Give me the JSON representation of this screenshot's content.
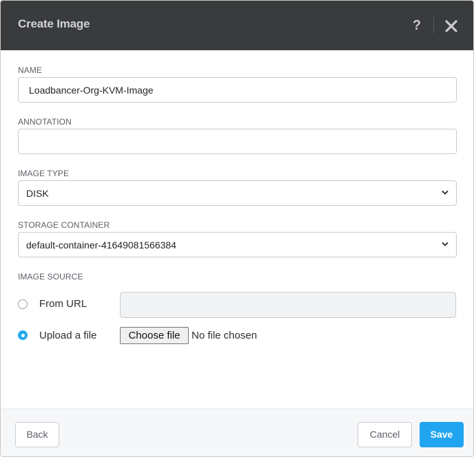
{
  "dialog": {
    "title": "Create Image",
    "help_icon": "?",
    "close_icon": "close-icon"
  },
  "form": {
    "name": {
      "label": "NAME",
      "value": "Loadbancer-Org-KVM-Image"
    },
    "annotation": {
      "label": "ANNOTATION",
      "value": ""
    },
    "image_type": {
      "label": "IMAGE TYPE",
      "selected": "DISK"
    },
    "storage_container": {
      "label": "STORAGE CONTAINER",
      "selected": "default-container-41649081566384"
    },
    "image_source": {
      "label": "IMAGE SOURCE",
      "options": [
        {
          "label": "From URL",
          "selected": false
        },
        {
          "label": "Upload a file",
          "selected": true
        }
      ],
      "url_value": "",
      "choose_file_label": "Choose file",
      "file_status": "No file chosen"
    }
  },
  "footer": {
    "back_label": "Back",
    "cancel_label": "Cancel",
    "save_label": "Save"
  },
  "colors": {
    "header_bg": "#3a3b3d",
    "accent": "#22a5f0"
  }
}
